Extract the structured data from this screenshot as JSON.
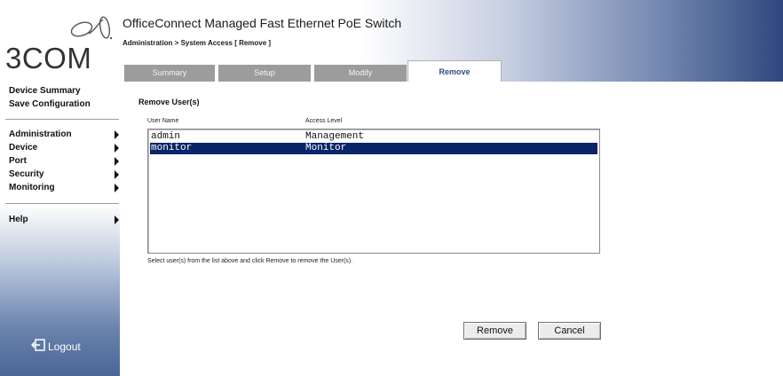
{
  "brand": {
    "logo_text": "3COM"
  },
  "header": {
    "title": "OfficeConnect Managed Fast Ethernet PoE Switch",
    "breadcrumb": "Administration > System Access [ Remove ]"
  },
  "tabs": [
    {
      "label": "Summary",
      "active": false
    },
    {
      "label": "Setup",
      "active": false
    },
    {
      "label": "Modify",
      "active": false
    },
    {
      "label": "Remove",
      "active": true
    }
  ],
  "sidebar": {
    "links": [
      "Device Summary",
      "Save Configuration"
    ],
    "menu": [
      {
        "label": "Administration",
        "icon": "chevron-right-icon"
      },
      {
        "label": "Device",
        "icon": "chevron-right-icon"
      },
      {
        "label": "Port",
        "icon": "chevron-right-icon"
      },
      {
        "label": "Security",
        "icon": "chevron-right-icon"
      },
      {
        "label": "Monitoring",
        "icon": "chevron-right-icon"
      }
    ],
    "help": {
      "label": "Help",
      "icon": "chevron-right-icon"
    },
    "logout": {
      "label": "Logout",
      "icon": "logout-icon"
    }
  },
  "main": {
    "section_title": "Remove User(s)",
    "columns": [
      "User Name",
      "Access Level"
    ],
    "users": [
      {
        "name": "admin",
        "level": "Management",
        "selected": false
      },
      {
        "name": "monitor",
        "level": "Monitor",
        "selected": true
      }
    ],
    "hint": "Select user(s) from the list above and click Remove to remove the User(s).",
    "buttons": {
      "remove": "Remove",
      "cancel": "Cancel"
    }
  },
  "colors": {
    "selection": "#0a246a",
    "active_tab_text": "#2f4a86",
    "header_gradient_end": "#2f477d",
    "inactive_tab": "#9c9c9c"
  }
}
